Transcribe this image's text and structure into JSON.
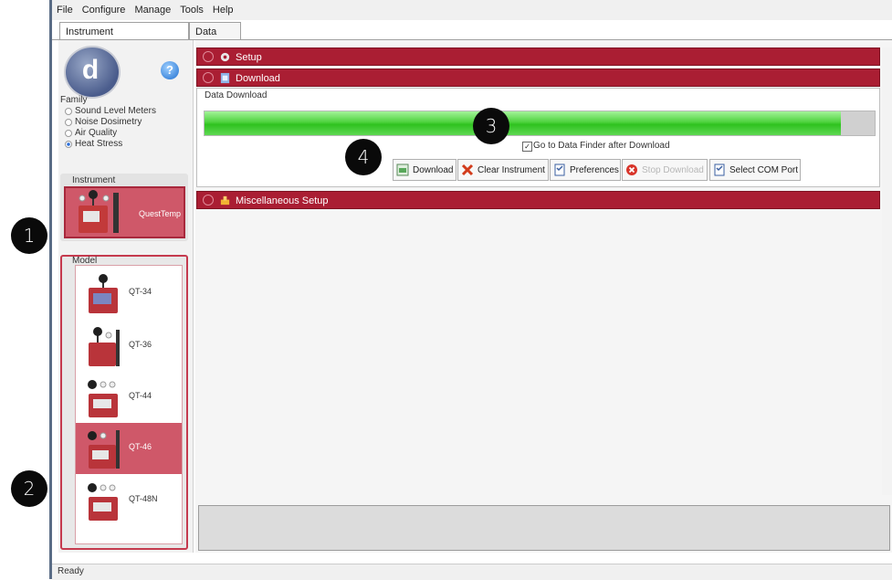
{
  "menu": [
    "File",
    "Configure",
    "Manage",
    "Tools",
    "Help"
  ],
  "tabs": [
    "Instrument Communications",
    "Data Finder"
  ],
  "family": {
    "label": "Family",
    "options": [
      {
        "label": "Sound Level Meters",
        "selected": false
      },
      {
        "label": "Noise Dosimetry",
        "selected": false
      },
      {
        "label": "Air Quality",
        "selected": false
      },
      {
        "label": "Heat Stress",
        "selected": true
      }
    ]
  },
  "instrument": {
    "label": "Instrument",
    "name": "QuestTemp"
  },
  "model": {
    "label": "Model",
    "items": [
      "QT-34",
      "QT-36",
      "QT-44",
      "QT-46",
      "QT-48N"
    ],
    "selected": "QT-46"
  },
  "sections": {
    "setup": "Setup",
    "download": "Download",
    "misc": "Miscellaneous Setup"
  },
  "download_panel": {
    "title": "Data Download",
    "progress": 0.95,
    "goto_checked": true,
    "goto_label": "Go to Data Finder after Download",
    "buttons": {
      "download": "Download",
      "clear": "Clear Instrument",
      "prefs": "Preferences",
      "stop": "Stop Download",
      "com": "Select COM Port"
    }
  },
  "status": "Ready",
  "callouts": [
    "1",
    "2",
    "3",
    "4"
  ],
  "colors": {
    "accent": "#aa1e33",
    "selected": "#cf5869",
    "progress": "#3fcf2f"
  }
}
